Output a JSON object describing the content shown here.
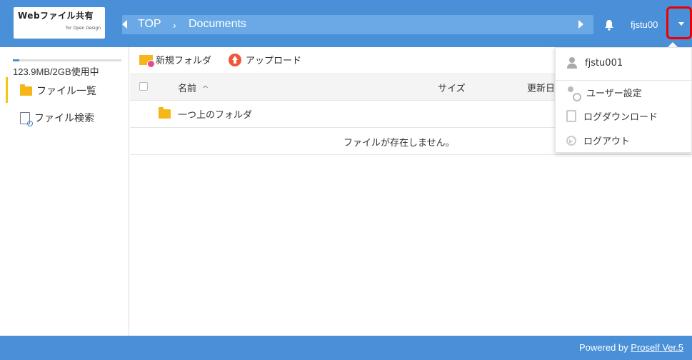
{
  "logo": {
    "title": "Webファイル共有",
    "subtitle": "for Open Design"
  },
  "breadcrumb": {
    "items": [
      "TOP",
      "Documents"
    ],
    "separator": "›"
  },
  "header": {
    "user_name": "fjstu00"
  },
  "sidebar": {
    "quota_text": "123.9MB/2GB使用中",
    "quota_used_fraction": 0.06,
    "items": [
      {
        "label": "ファイル一覧",
        "icon": "folder-icon"
      },
      {
        "label": "ファイル検索",
        "icon": "file-search-icon"
      }
    ]
  },
  "toolbar": {
    "new_folder_label": "新規フォルダ",
    "upload_label": "アップロード"
  },
  "table": {
    "headers": {
      "name": "名前",
      "sort_indicator": "^",
      "size": "サイズ",
      "date": "更新日"
    },
    "parent_folder_label": "一つ上のフォルダ",
    "empty_message": "ファイルが存在しません。"
  },
  "user_menu": {
    "user": "fjstu001",
    "items": [
      "ユーザー設定",
      "ログダウンロード",
      "ログアウト"
    ]
  },
  "footer": {
    "prefix": "Powered by",
    "link_text": "Proself Ver.5"
  },
  "colors": {
    "header_bg": "#4a90d9",
    "breadcrumb_bg": "#6aa9e6",
    "highlight_border": "#ee0000",
    "folder": "#f6b619"
  }
}
